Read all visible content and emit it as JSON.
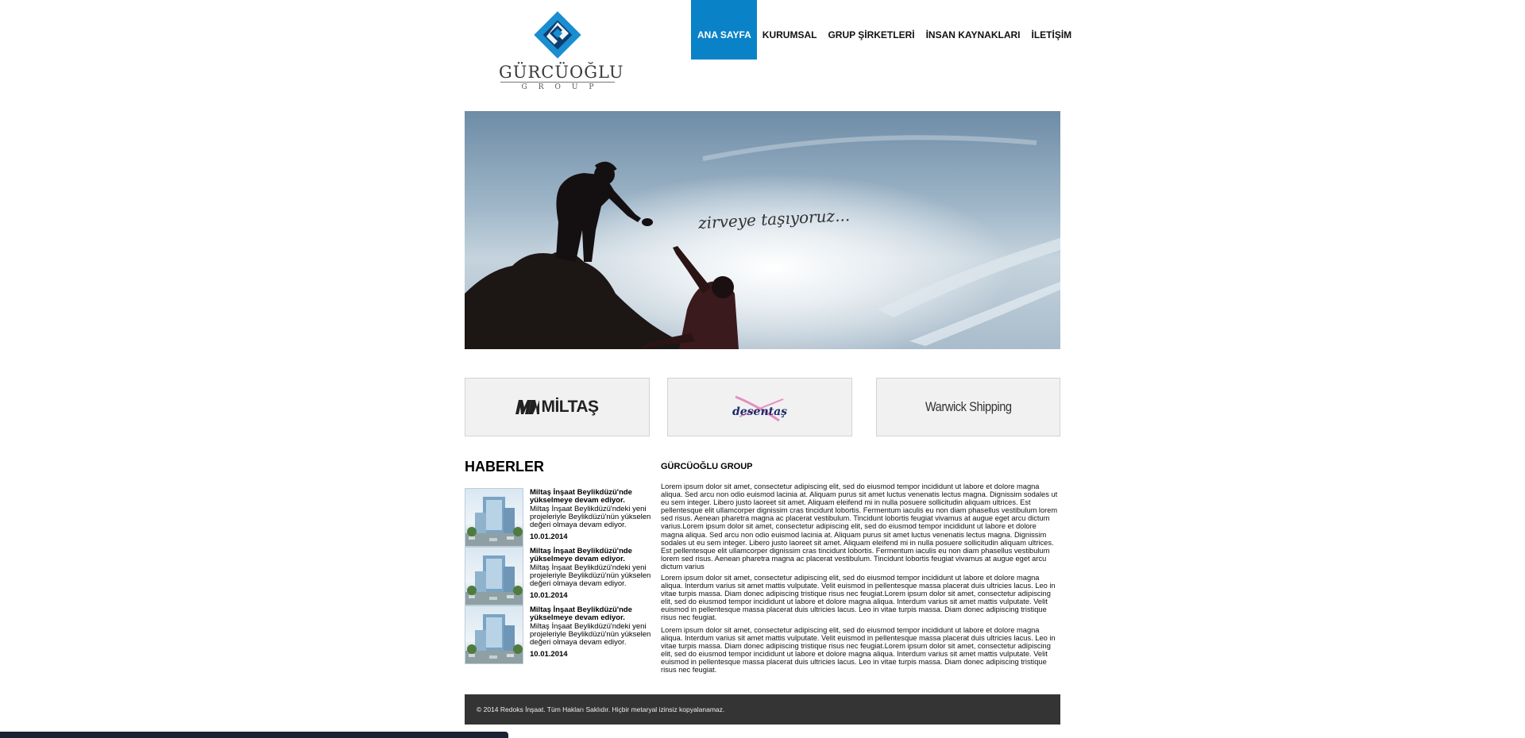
{
  "logo": {
    "name": "GÜRCÜOĞLU",
    "sub": "GROUP"
  },
  "nav": {
    "items": [
      {
        "label": "ANA SAYFA"
      },
      {
        "label": "KURUMSAL"
      },
      {
        "label": "GRUP ŞİRKETLERİ"
      },
      {
        "label": "İNSAN KAYNAKLARI"
      },
      {
        "label": "İLETİŞİM"
      }
    ]
  },
  "hero": {
    "caption": "zirveye taşıyoruz..."
  },
  "brands": [
    {
      "label": "MİLTAŞ"
    },
    {
      "label": "desentaş"
    },
    {
      "label": "Warwick Shipping"
    }
  ],
  "news": {
    "title": "HABERLER",
    "items": [
      {
        "headline": "Miltaş İnşaat Beylikdüzü'nde yükselmeye devam ediyor.",
        "summary": "Miltaş İnşaat Beylikdüzü'ndeki yeni projeleriyle Beylikdüzü'nün yükselen değeri olmaya devam ediyor.",
        "date": "10.01.2014"
      },
      {
        "headline": "Miltaş İnşaat Beylikdüzü'nde yükselmeye devam ediyor.",
        "summary": "Miltaş İnşaat Beylikdüzü'ndeki yeni projeleriyle Beylikdüzü'nün yükselen değeri olmaya devam ediyor.",
        "date": "10.01.2014"
      },
      {
        "headline": "Miltaş İnşaat Beylikdüzü'nde yükselmeye devam ediyor.",
        "summary": "Miltaş İnşaat Beylikdüzü'ndeki yeni projeleriyle Beylikdüzü'nün yükselen değeri olmaya devam ediyor.",
        "date": "10.01.2014"
      }
    ]
  },
  "about": {
    "title": "GÜRCÜOĞLU GROUP",
    "paragraphs": [
      "Lorem ipsum dolor sit amet, consectetur adipiscing elit, sed do eiusmod tempor incididunt ut labore et dolore magna aliqua. Sed arcu non odio euismod lacinia at. Aliquam purus sit amet luctus venenatis lectus magna. Dignissim sodales ut eu sem integer. Libero justo laoreet sit amet. Aliquam eleifend mi in nulla posuere sollicitudin aliquam ultrices. Est pellentesque elit ullamcorper dignissim cras tincidunt lobortis. Fermentum iaculis eu non diam phasellus vestibulum lorem sed risus. Aenean pharetra magna ac placerat vestibulum. Tincidunt lobortis feugiat vivamus at augue eget arcu dictum varius.Lorem ipsum dolor sit amet, consectetur adipiscing elit, sed do eiusmod tempor incididunt ut labore et dolore magna aliqua. Sed arcu non odio euismod lacinia at. Aliquam purus sit amet luctus venenatis lectus magna. Dignissim sodales ut eu sem integer. Libero justo laoreet sit amet. Aliquam eleifend mi in nulla posuere sollicitudin aliquam ultrices. Est pellentesque elit ullamcorper dignissim cras tincidunt lobortis. Fermentum iaculis eu non diam phasellus vestibulum lorem sed risus. Aenean pharetra magna ac placerat vestibulum. Tincidunt lobortis feugiat vivamus at augue eget arcu dictum varius",
      "Lorem ipsum dolor sit amet, consectetur adipiscing elit, sed do eiusmod tempor incididunt ut labore et dolore magna aliqua. Interdum varius sit amet mattis vulputate. Velit euismod in pellentesque massa placerat duis ultricies lacus. Leo in vitae turpis massa. Diam donec adipiscing tristique risus nec feugiat.Lorem ipsum dolor sit amet, consectetur adipiscing elit, sed do eiusmod tempor incididunt ut labore et dolore magna aliqua. Interdum varius sit amet mattis vulputate. Velit euismod in pellentesque massa placerat duis ultricies lacus. Leo in vitae turpis massa. Diam donec adipiscing tristique risus nec feugiat.",
      "Lorem ipsum dolor sit amet, consectetur adipiscing elit, sed do eiusmod tempor incididunt ut labore et dolore magna aliqua. Interdum varius sit amet mattis vulputate. Velit euismod in pellentesque massa placerat duis ultricies lacus. Leo in vitae turpis massa. Diam donec adipiscing tristique risus nec feugiat.Lorem ipsum dolor sit amet, consectetur adipiscing elit, sed do eiusmod tempor incididunt ut labore et dolore magna aliqua. Interdum varius sit amet mattis vulputate. Velit euismod in pellentesque massa placerat duis ultricies lacus. Leo in vitae turpis massa. Diam donec adipiscing tristique risus nec feugiat."
    ]
  },
  "footer": {
    "text": "© 2014 Redoks İnşaat. Tüm Hakları Saklıdır. Hiçbir metaryal izinsiz kopyalanamaz."
  },
  "colors": {
    "accent": "#0a82c7",
    "footer_bg": "#343434"
  }
}
